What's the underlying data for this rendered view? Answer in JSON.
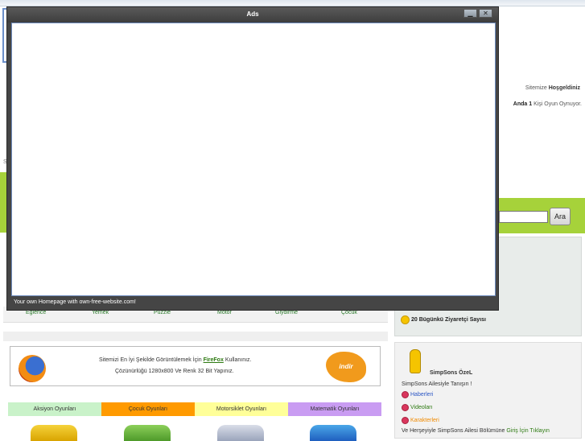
{
  "dialog": {
    "title": "Ads",
    "minimize_glyph": "▁",
    "close_glyph": "✕",
    "footer": "Your own Homepage with own-free-website.com!"
  },
  "header": {
    "welcome_prefix": "Sitemize",
    "welcome_bold": "Hoşgeldiniz",
    "online_prefix": "Anda 1",
    "online_suffix": "Kişi Oyun Oynuyor.",
    "stray_letter": "S"
  },
  "search": {
    "button_label": "Ara",
    "value": ""
  },
  "categories": [
    "Eğlence",
    "Yemek",
    "Puzzle",
    "Motor",
    "Giydirme",
    "Çocuk"
  ],
  "visitors": {
    "text": "20 Bügünkü Ziyaretçi Sayısı",
    "icon": "smiley-icon"
  },
  "firefox": {
    "line1_before": "Sitemizi En İyi Şekilde Görüntülemek İçin",
    "line1_link": "FireFox",
    "line1_after": "Kullanınız.",
    "line2": "Çözünürlüğü 1280x800 Ve Renk 32 Bit Yapınız.",
    "download_label": "indir"
  },
  "game_categories": [
    {
      "label": "Aksiyon Oyunları",
      "color": "#c9f2c9"
    },
    {
      "label": "Çocuk Oyunları",
      "color": "#ff9a00"
    },
    {
      "label": "Motorsiklet Oyunları",
      "color": "#ffff99"
    },
    {
      "label": "Matematik Oyunları",
      "color": "#c99cf2"
    }
  ],
  "simpsons": {
    "title": "SimpSons ÖzeL",
    "subtitle": "SimpSons Ailesiyle Tanışın !",
    "links": [
      {
        "label": "Haberleri",
        "color": "#2b56c4"
      },
      {
        "label": "Videoları",
        "color": "#2d7a11"
      },
      {
        "label": "Karakterleri",
        "color": "#f08a00"
      }
    ],
    "footer_before": "Ve Herşeyiyle SimpSons Ailesi Bölümüne",
    "footer_link": "Giriş İçin Tıklayın"
  }
}
